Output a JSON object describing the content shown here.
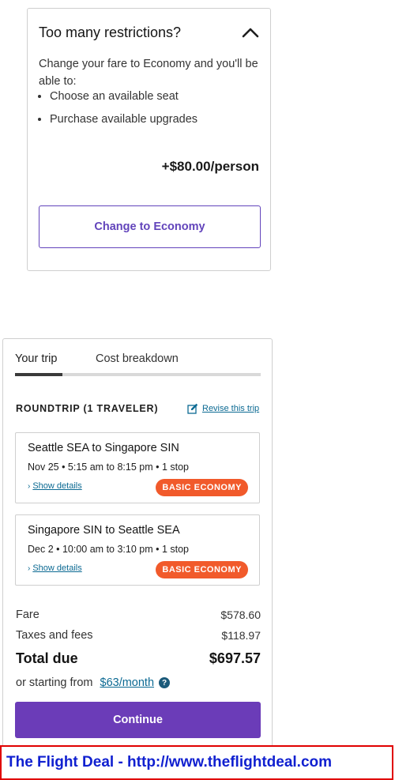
{
  "restrictions": {
    "title": "Too many restrictions?",
    "description": "Change your fare to Economy and you'll be able to:",
    "bullets": [
      "Choose an available seat",
      "Purchase available upgrades"
    ],
    "price": "+$80.00/person",
    "button_label": "Change to Economy",
    "collapse_icon": "chevron-up-icon"
  },
  "trip": {
    "tabs": [
      {
        "label": "Your trip",
        "active": true
      },
      {
        "label": "Cost breakdown",
        "active": false
      }
    ],
    "header": "ROUNDTRIP (1 TRAVELER)",
    "revise_label": "Revise this trip",
    "revise_icon": "edit-icon",
    "segments": [
      {
        "route": "Seattle SEA to Singapore SIN",
        "time": "Nov 25 • 5:15 am to 8:15 pm • 1 stop",
        "details_label": "Show details",
        "badge": "BASIC ECONOMY"
      },
      {
        "route": "Singapore SIN to Seattle SEA",
        "time": "Dec 2 • 10:00 am to 3:10 pm • 1 stop",
        "details_label": "Show details",
        "badge": "BASIC ECONOMY"
      }
    ],
    "fare_label": "Fare",
    "fare_value": "$578.60",
    "taxes_label": "Taxes and fees",
    "taxes_value": "$118.97",
    "total_label": "Total due",
    "total_value": "$697.57",
    "starting_label": "or starting from",
    "starting_link": "$63/month",
    "help_icon": "?",
    "continue_label": "Continue"
  },
  "banner": {
    "text": "The Flight Deal - http://www.theflightdeal.com"
  },
  "colors": {
    "accent": "#6b3cb8",
    "outline": "#6244bb",
    "badge": "#f15a2b",
    "link": "#0c6a93",
    "banner_border": "#e00000",
    "banner_text": "#1020d0"
  }
}
